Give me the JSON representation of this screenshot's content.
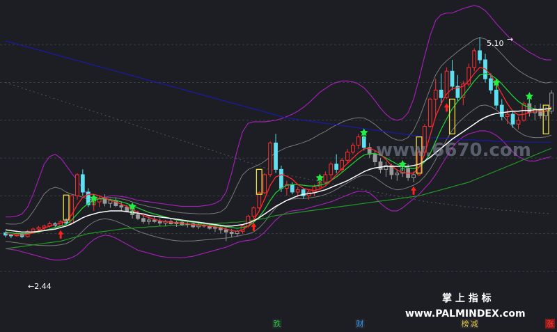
{
  "chart_data": {
    "type": "candlestick",
    "annotations": {
      "low_label": "←2.44",
      "high_label": "5.10",
      "high_arrow": "→"
    },
    "watermarks": {
      "center": "www.6670.com",
      "brand": "掌 上 指 标",
      "url": "www.PALMINDEX.com"
    },
    "bottom_tags": [
      {
        "text": "跌",
        "color": "#2ecc40"
      },
      {
        "text": "财",
        "color": "#3b9dff"
      },
      {
        "text": "榜",
        "color": "#e8c547"
      },
      {
        "text": "减",
        "color": "#e8c547"
      },
      {
        "text": "涨",
        "color": "#ff3b3b"
      }
    ],
    "colors": {
      "up": "#ff3030",
      "down": "#5ee0f0",
      "neutral": "#9a9a9a",
      "ma_white": "#ffffff",
      "ma_red": "#ff2a2a",
      "ma_green": "#22cc33",
      "long_ma_green": "#229922",
      "long_ma_blue": "#1a1aa8",
      "band_purple": "#a020b0",
      "band_gray": "#7a7a7a",
      "grid": "#3a3c44",
      "buy_arrow": "#ff2020",
      "sell_star": "#22ee44",
      "box": "#f0e040"
    },
    "price_range": [
      1.4,
      5.5
    ],
    "price_ticks": [
      2.0,
      2.5,
      3.0,
      3.5,
      4.0,
      4.5,
      5.0
    ],
    "index_count": 100,
    "ohlc": [
      [
        2.51,
        2.53,
        2.45,
        2.48
      ],
      [
        2.48,
        2.5,
        2.44,
        2.47
      ],
      [
        2.47,
        2.52,
        2.46,
        2.5
      ],
      [
        2.5,
        2.51,
        2.44,
        2.46
      ],
      [
        2.46,
        2.55,
        2.45,
        2.53
      ],
      [
        2.53,
        2.58,
        2.5,
        2.56
      ],
      [
        2.56,
        2.6,
        2.53,
        2.58
      ],
      [
        2.58,
        2.62,
        2.55,
        2.6
      ],
      [
        2.6,
        2.66,
        2.58,
        2.63
      ],
      [
        2.63,
        2.65,
        2.59,
        2.61
      ],
      [
        2.61,
        2.68,
        2.6,
        2.66
      ],
      [
        2.66,
        2.7,
        2.62,
        2.64
      ],
      [
        2.64,
        3.01,
        2.63,
        3.0
      ],
      [
        3.0,
        3.3,
        2.95,
        3.28
      ],
      [
        3.28,
        3.35,
        3.0,
        3.05
      ],
      [
        3.05,
        3.1,
        2.85,
        2.88
      ],
      [
        2.88,
        2.95,
        2.8,
        2.92
      ],
      [
        2.92,
        3.0,
        2.85,
        2.97
      ],
      [
        2.97,
        3.02,
        2.86,
        2.9
      ],
      [
        2.9,
        2.96,
        2.84,
        2.94
      ],
      [
        2.94,
        2.98,
        2.85,
        2.87
      ],
      [
        2.87,
        2.92,
        2.8,
        2.85
      ],
      [
        2.85,
        2.88,
        2.78,
        2.8
      ],
      [
        2.8,
        2.84,
        2.7,
        2.75
      ],
      [
        2.75,
        2.8,
        2.68,
        2.7
      ],
      [
        2.7,
        2.74,
        2.63,
        2.66
      ],
      [
        2.66,
        2.72,
        2.62,
        2.68
      ],
      [
        2.68,
        2.73,
        2.64,
        2.66
      ],
      [
        2.66,
        2.7,
        2.6,
        2.64
      ],
      [
        2.64,
        2.68,
        2.6,
        2.66
      ],
      [
        2.66,
        2.7,
        2.62,
        2.63
      ],
      [
        2.63,
        2.67,
        2.59,
        2.65
      ],
      [
        2.65,
        2.68,
        2.6,
        2.62
      ],
      [
        2.62,
        2.66,
        2.58,
        2.63
      ],
      [
        2.63,
        2.66,
        2.57,
        2.59
      ],
      [
        2.59,
        2.64,
        2.56,
        2.61
      ],
      [
        2.61,
        2.65,
        2.58,
        2.6
      ],
      [
        2.6,
        2.63,
        2.55,
        2.57
      ],
      [
        2.57,
        2.61,
        2.52,
        2.58
      ],
      [
        2.58,
        2.62,
        2.5,
        2.55
      ],
      [
        2.55,
        2.6,
        2.4,
        2.52
      ],
      [
        2.52,
        2.56,
        2.45,
        2.5
      ],
      [
        2.5,
        2.55,
        2.46,
        2.53
      ],
      [
        2.53,
        2.62,
        2.5,
        2.6
      ],
      [
        2.6,
        2.75,
        2.58,
        2.73
      ],
      [
        2.73,
        2.86,
        2.7,
        2.84
      ],
      [
        2.84,
        3.06,
        2.82,
        3.04
      ],
      [
        3.04,
        3.3,
        3.02,
        3.28
      ],
      [
        3.28,
        3.72,
        3.25,
        3.7
      ],
      [
        3.7,
        3.82,
        3.3,
        3.35
      ],
      [
        3.35,
        3.4,
        3.05,
        3.1
      ],
      [
        3.1,
        3.2,
        3.0,
        3.15
      ],
      [
        3.15,
        3.18,
        3.02,
        3.05
      ],
      [
        3.05,
        3.12,
        2.98,
        3.08
      ],
      [
        3.08,
        3.1,
        2.96,
        3.0
      ],
      [
        3.0,
        3.08,
        2.95,
        3.05
      ],
      [
        3.05,
        3.15,
        3.0,
        3.12
      ],
      [
        3.12,
        3.22,
        3.08,
        3.18
      ],
      [
        3.18,
        3.32,
        3.15,
        3.28
      ],
      [
        3.28,
        3.45,
        3.22,
        3.42
      ],
      [
        3.42,
        3.55,
        3.3,
        3.35
      ],
      [
        3.35,
        3.5,
        3.32,
        3.47
      ],
      [
        3.47,
        3.62,
        3.42,
        3.58
      ],
      [
        3.58,
        3.7,
        3.55,
        3.67
      ],
      [
        3.67,
        3.82,
        3.62,
        3.78
      ],
      [
        3.78,
        3.82,
        3.6,
        3.64
      ],
      [
        3.64,
        3.7,
        3.5,
        3.55
      ],
      [
        3.55,
        3.6,
        3.4,
        3.45
      ],
      [
        3.45,
        3.5,
        3.3,
        3.35
      ],
      [
        3.35,
        3.45,
        3.25,
        3.4
      ],
      [
        3.4,
        3.42,
        3.22,
        3.28
      ],
      [
        3.28,
        3.35,
        3.2,
        3.3
      ],
      [
        3.3,
        3.4,
        3.25,
        3.36
      ],
      [
        3.36,
        3.42,
        3.2,
        3.24
      ],
      [
        3.24,
        3.32,
        3.18,
        3.28
      ],
      [
        3.28,
        3.6,
        3.26,
        3.58
      ],
      [
        3.58,
        3.95,
        3.55,
        3.92
      ],
      [
        3.92,
        4.3,
        3.9,
        4.28
      ],
      [
        4.28,
        4.55,
        4.05,
        4.4
      ],
      [
        4.4,
        4.62,
        4.2,
        4.3
      ],
      [
        4.3,
        4.7,
        4.28,
        4.65
      ],
      [
        4.65,
        4.8,
        4.4,
        4.45
      ],
      [
        4.45,
        4.6,
        4.25,
        4.3
      ],
      [
        4.3,
        4.52,
        4.2,
        4.48
      ],
      [
        4.48,
        4.75,
        4.45,
        4.7
      ],
      [
        4.7,
        4.95,
        4.65,
        4.92
      ],
      [
        4.92,
        5.1,
        4.75,
        4.8
      ],
      [
        4.8,
        4.88,
        4.5,
        4.55
      ],
      [
        4.55,
        4.62,
        4.35,
        4.4
      ],
      [
        4.4,
        4.48,
        4.15,
        4.2
      ],
      [
        4.2,
        4.28,
        4.0,
        4.05
      ],
      [
        4.05,
        4.15,
        3.95,
        4.08
      ],
      [
        4.08,
        4.12,
        3.9,
        3.95
      ],
      [
        3.95,
        4.05,
        3.88,
        4.0
      ],
      [
        4.0,
        4.25,
        3.98,
        4.22
      ],
      [
        4.22,
        4.3,
        4.05,
        4.1
      ],
      [
        4.1,
        4.2,
        4.0,
        4.15
      ],
      [
        4.15,
        4.22,
        4.02,
        4.06
      ],
      [
        4.06,
        4.18,
        4.0,
        4.12
      ],
      [
        4.12,
        4.4,
        4.08,
        4.36
      ]
    ],
    "ma_white": [
      2.55,
      2.54,
      2.53,
      2.52,
      2.52,
      2.52,
      2.53,
      2.54,
      2.55,
      2.56,
      2.58,
      2.6,
      2.63,
      2.67,
      2.71,
      2.74,
      2.76,
      2.78,
      2.79,
      2.8,
      2.8,
      2.8,
      2.79,
      2.78,
      2.77,
      2.76,
      2.74,
      2.73,
      2.72,
      2.71,
      2.7,
      2.69,
      2.68,
      2.67,
      2.66,
      2.65,
      2.64,
      2.63,
      2.62,
      2.61,
      2.6,
      2.6,
      2.61,
      2.62,
      2.64,
      2.67,
      2.71,
      2.76,
      2.81,
      2.86,
      2.9,
      2.94,
      2.97,
      3.0,
      3.02,
      3.03,
      3.04,
      3.06,
      3.08,
      3.11,
      3.14,
      3.17,
      3.2,
      3.24,
      3.28,
      3.32,
      3.35,
      3.37,
      3.38,
      3.39,
      3.39,
      3.39,
      3.39,
      3.39,
      3.4,
      3.42,
      3.46,
      3.51,
      3.57,
      3.63,
      3.69,
      3.75,
      3.8,
      3.85,
      3.9,
      3.95,
      4.0,
      4.04,
      4.07,
      4.09,
      4.1,
      4.11,
      4.12,
      4.12,
      4.13,
      4.13,
      4.14,
      4.14,
      4.15,
      4.16
    ],
    "ma_red": [
      2.5,
      2.49,
      2.48,
      2.48,
      2.49,
      2.51,
      2.54,
      2.57,
      2.6,
      2.62,
      2.64,
      2.66,
      2.75,
      2.88,
      2.98,
      3.02,
      3.02,
      3.0,
      2.97,
      2.94,
      2.92,
      2.89,
      2.86,
      2.82,
      2.78,
      2.74,
      2.71,
      2.69,
      2.67,
      2.66,
      2.65,
      2.64,
      2.64,
      2.63,
      2.62,
      2.61,
      2.61,
      2.6,
      2.59,
      2.58,
      2.56,
      2.54,
      2.53,
      2.55,
      2.6,
      2.68,
      2.8,
      2.96,
      3.14,
      3.25,
      3.28,
      3.26,
      3.22,
      3.15,
      3.1,
      3.08,
      3.07,
      3.09,
      3.13,
      3.2,
      3.28,
      3.36,
      3.43,
      3.5,
      3.57,
      3.62,
      3.63,
      3.6,
      3.55,
      3.48,
      3.4,
      3.34,
      3.31,
      3.3,
      3.3,
      3.38,
      3.55,
      3.8,
      4.05,
      4.22,
      4.35,
      4.42,
      4.43,
      4.45,
      4.52,
      4.62,
      4.7,
      4.68,
      4.6,
      4.48,
      4.35,
      4.22,
      4.12,
      4.07,
      4.08,
      4.1,
      4.12,
      4.12,
      4.12,
      4.18
    ],
    "ma_green": [
      2.52,
      2.51,
      2.5,
      2.5,
      2.5,
      2.51,
      2.52,
      2.54,
      2.56,
      2.58,
      2.6,
      2.62,
      2.68,
      2.76,
      2.84,
      2.9,
      2.94,
      2.96,
      2.96,
      2.95,
      2.94,
      2.92,
      2.9,
      2.87,
      2.84,
      2.81,
      2.78,
      2.76,
      2.74,
      2.72,
      2.7,
      2.68,
      2.67,
      2.66,
      2.65,
      2.64,
      2.63,
      2.62,
      2.61,
      2.6,
      2.59,
      2.58,
      2.57,
      2.58,
      2.6,
      2.65,
      2.72,
      2.82,
      2.94,
      3.04,
      3.1,
      3.14,
      3.15,
      3.15,
      3.14,
      3.13,
      3.13,
      3.14,
      3.16,
      3.2,
      3.25,
      3.31,
      3.37,
      3.43,
      3.49,
      3.54,
      3.56,
      3.56,
      3.54,
      3.5,
      3.46,
      3.42,
      3.39,
      3.37,
      3.36,
      3.38,
      3.45,
      3.56,
      3.72,
      3.88,
      4.02,
      4.15,
      4.25,
      4.33,
      4.42,
      4.52,
      4.6,
      4.62,
      4.6,
      4.55,
      4.48,
      4.4,
      4.32,
      4.25,
      4.2,
      4.17,
      4.15,
      4.13,
      4.12,
      4.15
    ],
    "long_ma_green": [
      2.3,
      2.31,
      2.32,
      2.33,
      2.34,
      2.35,
      2.36,
      2.37,
      2.38,
      2.39,
      2.4,
      2.42,
      2.44,
      2.46,
      2.48,
      2.5,
      2.51,
      2.52,
      2.53,
      2.54,
      2.55,
      2.56,
      2.57,
      2.57,
      2.58,
      2.58,
      2.59,
      2.59,
      2.6,
      2.6,
      2.61,
      2.61,
      2.61,
      2.62,
      2.62,
      2.62,
      2.63,
      2.63,
      2.63,
      2.64,
      2.64,
      2.65,
      2.65,
      2.66,
      2.67,
      2.68,
      2.69,
      2.7,
      2.72,
      2.74,
      2.75,
      2.76,
      2.77,
      2.78,
      2.79,
      2.8,
      2.81,
      2.82,
      2.83,
      2.84,
      2.85,
      2.86,
      2.87,
      2.88,
      2.89,
      2.9,
      2.91,
      2.92,
      2.93,
      2.94,
      2.95,
      2.96,
      2.97,
      2.98,
      2.99,
      3.0,
      3.02,
      3.04,
      3.06,
      3.08,
      3.1,
      3.12,
      3.14,
      3.16,
      3.18,
      3.21,
      3.24,
      3.27,
      3.3,
      3.33,
      3.36,
      3.39,
      3.42,
      3.45,
      3.48,
      3.51,
      3.54,
      3.57,
      3.6,
      3.63
    ],
    "long_ma_blue": [
      5.05,
      5.03,
      5.01,
      4.99,
      4.97,
      4.95,
      4.93,
      4.91,
      4.89,
      4.87,
      4.85,
      4.83,
      4.81,
      4.79,
      4.77,
      4.75,
      4.73,
      4.71,
      4.69,
      4.67,
      4.65,
      4.63,
      4.61,
      4.59,
      4.57,
      4.55,
      4.53,
      4.51,
      4.49,
      4.47,
      4.45,
      4.43,
      4.41,
      4.39,
      4.37,
      4.35,
      4.33,
      4.31,
      4.29,
      4.27,
      4.25,
      4.23,
      4.21,
      4.19,
      4.17,
      4.15,
      4.13,
      4.11,
      4.09,
      4.07,
      4.05,
      4.03,
      4.02,
      4.01,
      4.0,
      3.99,
      3.98,
      3.97,
      3.96,
      3.95,
      3.94,
      3.93,
      3.92,
      3.91,
      3.9,
      3.89,
      3.88,
      3.87,
      3.86,
      3.85,
      3.84,
      3.83,
      3.82,
      3.81,
      3.8,
      3.79,
      3.78,
      3.77,
      3.77,
      3.76,
      3.76,
      3.75,
      3.75,
      3.74,
      3.74,
      3.74,
      3.73,
      3.73,
      3.73,
      3.72,
      3.72,
      3.72,
      3.72,
      3.72,
      3.71,
      3.71,
      3.71,
      3.71,
      3.71,
      3.71
    ],
    "upper_band": [
      2.72,
      2.72,
      2.73,
      2.76,
      2.85,
      3.02,
      3.22,
      3.42,
      3.52,
      3.55,
      3.5,
      3.4,
      3.3,
      3.2,
      3.1,
      3.0,
      2.96,
      2.96,
      2.98,
      3.0,
      3.0,
      2.99,
      2.98,
      2.96,
      2.94,
      2.93,
      2.92,
      2.91,
      2.9,
      2.89,
      2.88,
      2.87,
      2.86,
      2.86,
      2.86,
      2.86,
      2.87,
      2.88,
      2.9,
      2.94,
      3.05,
      3.3,
      3.6,
      3.85,
      3.96,
      3.98,
      3.98,
      3.98,
      3.99,
      4.0,
      4.02,
      4.05,
      4.08,
      4.12,
      4.17,
      4.23,
      4.3,
      4.37,
      4.42,
      4.47,
      4.5,
      4.52,
      4.52,
      4.51,
      4.48,
      4.43,
      4.35,
      4.26,
      4.16,
      4.08,
      4.02,
      4.0,
      4.02,
      4.1,
      4.28,
      4.55,
      4.85,
      5.12,
      5.32,
      5.4,
      5.42,
      5.42,
      5.45,
      5.48,
      5.5,
      5.52,
      5.5,
      5.45,
      5.37,
      5.28,
      5.2,
      5.12,
      5.05,
      5.0,
      4.95,
      4.9,
      4.86,
      4.82,
      4.8,
      4.8
    ],
    "lower_band": [
      2.3,
      2.29,
      2.28,
      2.26,
      2.24,
      2.22,
      2.2,
      2.18,
      2.16,
      2.15,
      2.15,
      2.16,
      2.18,
      2.22,
      2.28,
      2.36,
      2.42,
      2.46,
      2.48,
      2.47,
      2.44,
      2.4,
      2.36,
      2.32,
      2.28,
      2.26,
      2.24,
      2.22,
      2.2,
      2.19,
      2.18,
      2.18,
      2.18,
      2.19,
      2.2,
      2.22,
      2.24,
      2.26,
      2.28,
      2.3,
      2.32,
      2.35,
      2.38,
      2.4,
      2.41,
      2.42,
      2.46,
      2.52,
      2.6,
      2.68,
      2.74,
      2.78,
      2.8,
      2.81,
      2.82,
      2.84,
      2.86,
      2.88,
      2.9,
      2.92,
      2.95,
      2.98,
      3.01,
      3.04,
      3.06,
      3.06,
      3.04,
      2.98,
      2.9,
      2.84,
      2.8,
      2.8,
      2.84,
      2.9,
      2.96,
      3.02,
      3.1,
      3.18,
      3.28,
      3.4,
      3.52,
      3.64,
      3.72,
      3.78,
      3.82,
      3.84,
      3.86,
      3.86,
      3.84,
      3.8,
      3.74,
      3.66,
      3.58,
      3.52,
      3.48,
      3.46,
      3.46,
      3.48,
      3.5,
      3.52
    ],
    "boxes": [
      {
        "i": 11,
        "top": 3.01,
        "bottom": 2.68
      },
      {
        "i": 46,
        "top": 3.35,
        "bottom": 3.02
      },
      {
        "i": 75,
        "top": 3.78,
        "bottom": 3.3
      },
      {
        "i": 81,
        "top": 4.28,
        "bottom": 3.82
      },
      {
        "i": 98,
        "top": 4.2,
        "bottom": 3.82
      }
    ],
    "buy_arrows": [
      10,
      45,
      74,
      80
    ],
    "sell_stars": [
      16,
      23,
      57,
      65,
      72,
      89,
      95
    ]
  }
}
